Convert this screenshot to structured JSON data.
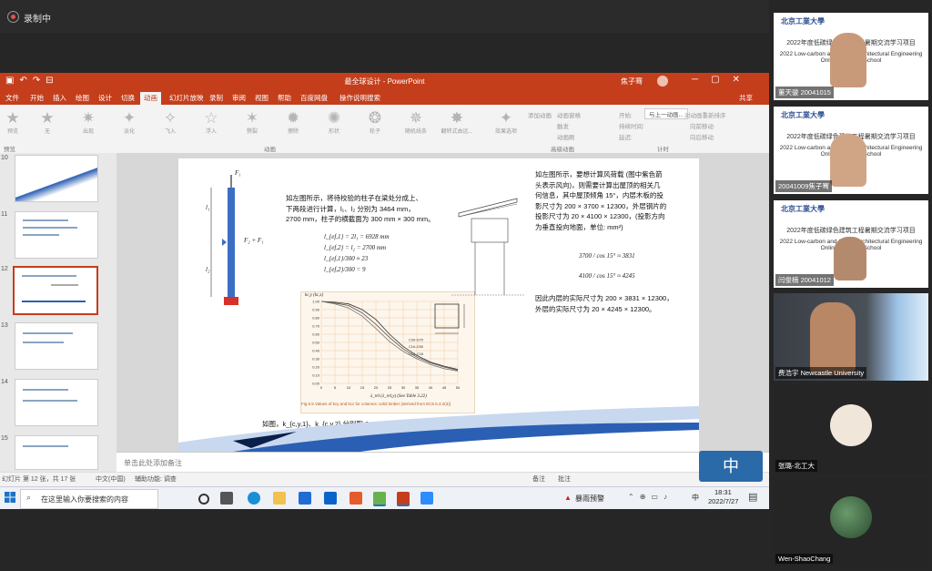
{
  "recording": {
    "label": "录制中"
  },
  "ppt": {
    "title": "最全球设计 - PowerPoint",
    "user": "焦子骞",
    "tabs": [
      "文件",
      "开始",
      "插入",
      "绘图",
      "设计",
      "切换",
      "动画",
      "幻灯片放映",
      "录制",
      "审阅",
      "视图",
      "帮助",
      "百度网盘",
      "操作说明搜索"
    ],
    "active_tab": "动画",
    "share": "共享",
    "preview_label": "预览",
    "animations": [
      "无",
      "出现",
      "淡化",
      "飞入",
      "浮入",
      "劈裂",
      "擦除",
      "形状",
      "轮子",
      "随机线条",
      "翻转式由远..."
    ],
    "effect_options": "效果选项",
    "group_preview": "预览",
    "group_animation": "动画",
    "group_advanced": "高级动画",
    "group_timing": "计时",
    "advanced": [
      "添加动画",
      "动画窗格",
      "触发",
      "动画刷"
    ],
    "timing": {
      "start_label": "开始:",
      "start_value": "与上一动画...",
      "duration": "持续时间:",
      "delay": "延迟:",
      "reorder": "对动画重新排序",
      "earlier": "向前移动",
      "later": "向后移动"
    },
    "thumb_numbers": [
      "10",
      "11",
      "12",
      "13",
      "14",
      "15"
    ],
    "notes_placeholder": "单击此处添加备注",
    "status_left": "幻灯片 第 12 张，共 17 张",
    "status_lang": "中文(中国)",
    "status_access": "辅助功能: 调查",
    "status_notes": "备注",
    "status_comments": "批注"
  },
  "slide": {
    "left_text": [
      "如左图所示，将待校验的柱子在梁处分成上、",
      "下两段进行计算，l₁、l₂ 分别为 3464 mm，",
      "2700 mm，柱子的横截面为 300 mm × 300 mm。"
    ],
    "equations": [
      "l_{ef,1} = 2l₁ = 6928 mm",
      "l_{ef,2} = l₂ = 2700 mm",
      "l_{ef,1}/300 ≈ 23",
      "l_{ef,2}/300 = 9"
    ],
    "column_labels": {
      "f1": "F₁",
      "l1": "l₁",
      "l2": "l₂",
      "load": "F₂ + F₁"
    },
    "right_text": [
      "如左图所示，要想计算风荷载 (图中紫色箭",
      "头表示风向)，则需要计算出屋顶的相关几",
      "何信息，其中屋顶倾角 15°，内层木板的投",
      "影尺寸为 200 × 3700 × 12300，外层钢片的",
      "投影尺寸为 20 × 4100 × 12300，(投影方向",
      "为垂直投向地面，单位: mm²)"
    ],
    "right_eq": [
      "3700 / cos 15° ≈ 3831",
      "4100 / cos 15° ≈ 4245"
    ],
    "right_conclusion": [
      "因此内层的实际尺寸为 200 × 3831 × 12300，",
      "外层的实际尺寸为 20 × 4245 × 12300。"
    ],
    "bottom_text": "如图，k_{c,y,1}、k_{c,y,2} 分别取 0.44、0.92。",
    "fig_caption": "Fig 6.5 Values of kcy and kcz for columns: solid timber (derived from EC5 6.3.2(3))",
    "fig_axis_x": "λ_rel (λ_rel,y) (See Table 3.22)",
    "fig_axis_y": "kc,y (kc,z)",
    "fig_legend": [
      "C30–D70",
      "C16–D30",
      "C14–C16"
    ]
  },
  "chart_data": {
    "type": "line",
    "title": "",
    "xlabel": "λ_rel",
    "ylabel": "kc",
    "x": [
      0,
      5,
      10,
      15,
      20,
      25,
      30,
      35,
      40,
      45,
      50
    ],
    "series": [
      {
        "name": "C30–D70",
        "values": [
          1.0,
          0.99,
          0.97,
          0.9,
          0.78,
          0.6,
          0.45,
          0.34,
          0.26,
          0.21,
          0.17
        ]
      },
      {
        "name": "C16–D30",
        "values": [
          1.0,
          0.98,
          0.95,
          0.86,
          0.72,
          0.56,
          0.42,
          0.32,
          0.25,
          0.2,
          0.16
        ]
      },
      {
        "name": "C14–C16",
        "values": [
          1.0,
          0.97,
          0.92,
          0.82,
          0.67,
          0.51,
          0.39,
          0.3,
          0.23,
          0.18,
          0.15
        ]
      }
    ],
    "xlim": [
      0,
      50
    ],
    "ylim": [
      0,
      1.0
    ],
    "xticks": [
      "0",
      "5",
      "10",
      "15",
      "20",
      "25",
      "30",
      "35",
      "40",
      "45",
      "50"
    ],
    "yticks": [
      "0.00",
      "0.10",
      "0.20",
      "0.30",
      "0.40",
      "0.50",
      "0.60",
      "0.70",
      "0.80",
      "0.90",
      "1.00"
    ],
    "grid": true
  },
  "taskbar": {
    "search_placeholder": "在这里输入你要搜索的内容",
    "weather": "暴雨预警",
    "ime": "中",
    "time": "18:31",
    "date": "2022/7/27"
  },
  "participants": [
    {
      "name": "董天骏 20041015",
      "banner_cn": "2022年度低碳绿色建筑工程暑期交流学习项目",
      "banner_en": "2022 Low-carbon and Green Architectural Engineering Online Summer School",
      "uni": "北京工業大學"
    },
    {
      "name": "20041009焦子骞",
      "banner_cn": "2022年度低碳绿色建筑工程暑期交流学习项目",
      "banner_en": "2022 Low-carbon and Green Architectural Engineering Online Summer School",
      "uni": "北京工業大學"
    },
    {
      "name": "闫俊楠 20041012",
      "banner_cn": "2022年度低碳绿色建筑工程暑期交流学习项目",
      "banner_en": "2022 Low-carbon and Green Architectural Engineering Online Summer School",
      "uni": "北京工業大學"
    },
    {
      "name": "费浩宇 Newcastle University"
    },
    {
      "name": "张璐-北工大"
    },
    {
      "name": "Wen-ShaoChang"
    }
  ],
  "colors": {
    "ppt_red": "#c43e1c",
    "column_blue": "#3b6fc6",
    "base_red": "#d9302a"
  }
}
